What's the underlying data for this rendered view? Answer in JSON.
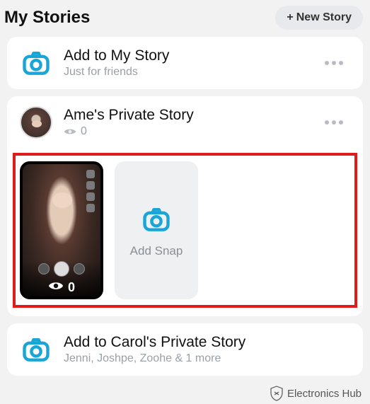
{
  "header": {
    "title": "My Stories",
    "new_story_label": "New Story"
  },
  "rows": {
    "my_story": {
      "title": "Add to My Story",
      "subtitle": "Just for friends"
    },
    "private_story": {
      "title": "Ame's Private Story",
      "view_count": "0",
      "snap_thumb_views": "0",
      "add_snap_label": "Add Snap"
    },
    "carol_story": {
      "title": "Add to Carol's Private Story",
      "subtitle": "Jenni, Joshpe, Zoohe & 1 more"
    }
  },
  "watermark": "Electronics Hub"
}
